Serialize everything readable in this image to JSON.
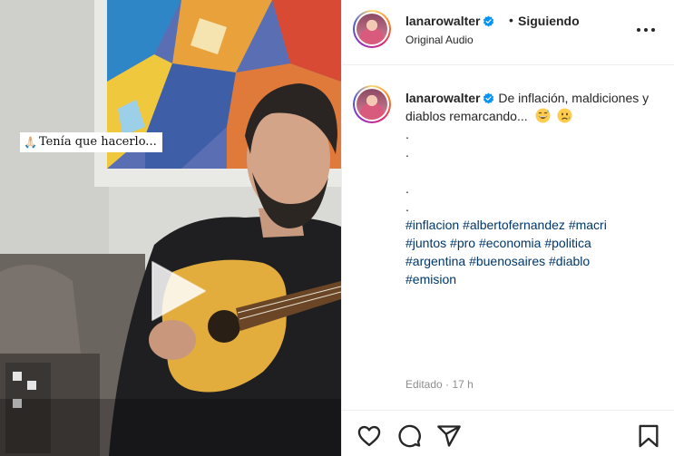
{
  "media": {
    "overlay_emoji": "🙏🏻",
    "overlay_text": "Tenía que hacerlo...",
    "play_icon": "play-icon"
  },
  "header": {
    "username": "lanarowalter",
    "separator": "•",
    "follow_status": "Siguiendo",
    "audio_label": "Original Audio",
    "more_icon": "more-options-icon"
  },
  "caption": {
    "username": "lanarowalter",
    "text": "De inflación, maldiciones y diablos remarcando...",
    "dots": [
      ".",
      ".",
      "",
      ".",
      "."
    ],
    "hashtags": [
      "#inflacion",
      "#albertofernandez",
      "#macri",
      "#juntos",
      "#pro",
      "#economia",
      "#politica",
      "#argentina",
      "#buenosaires",
      "#diablo",
      "#emision"
    ],
    "edited_label": "Editado",
    "separator": "·",
    "time_ago": "17 h"
  },
  "actions": {
    "like_icon": "heart-icon",
    "comment_icon": "comment-icon",
    "share_icon": "share-icon",
    "save_icon": "bookmark-icon"
  },
  "colors": {
    "verified": "#0095f6",
    "hashtag": "#00376b",
    "muted": "#8e8e8e"
  }
}
